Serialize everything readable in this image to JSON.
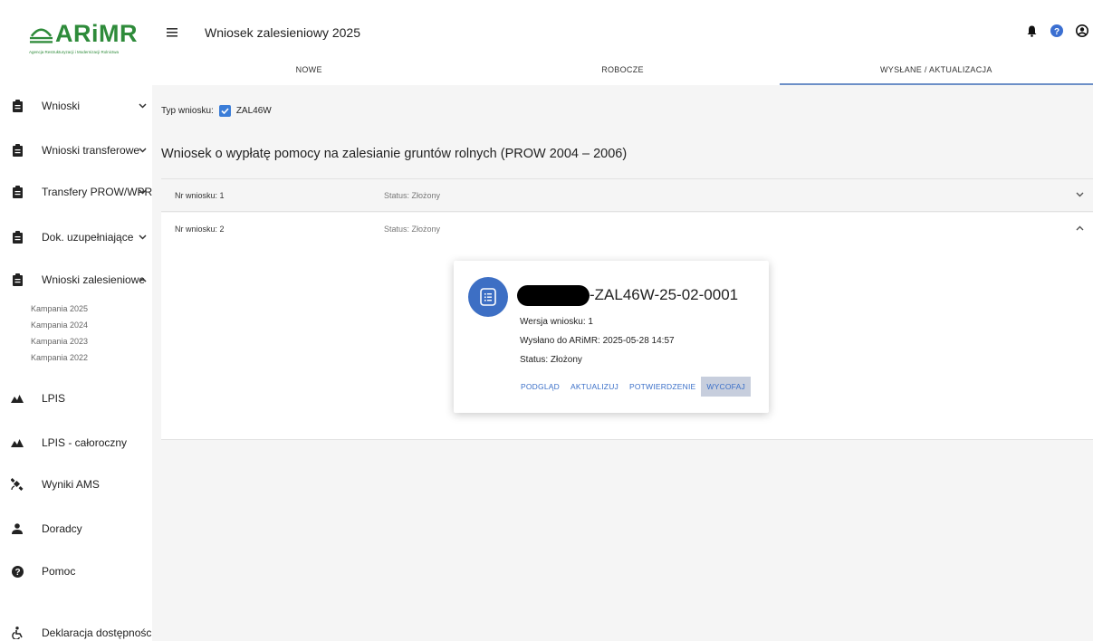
{
  "logo": {
    "text": "ARiMR",
    "subtitle": "Agencja Restrukturyzacji i Modernizacji Rolnictwa"
  },
  "sidebar": {
    "items": [
      {
        "label": "Wnioski",
        "icon": "clipboard-icon",
        "chevron": "⌄"
      },
      {
        "label": "Wnioski transferowe",
        "icon": "clipboard-icon",
        "chevron": "⌄"
      },
      {
        "label": "Transfery PROW/WPR",
        "icon": "clipboard-icon",
        "chevron": "⌄"
      },
      {
        "label": "Dok. uzupełniające",
        "icon": "clipboard-icon",
        "chevron": "⌄"
      },
      {
        "label": "Wnioski zalesieniowe",
        "icon": "clipboard-icon",
        "chevron": "^"
      },
      {
        "label": "LPIS",
        "icon": "mountain-icon"
      },
      {
        "label": "LPIS - całoroczny",
        "icon": "mountain-icon"
      },
      {
        "label": "Wyniki AMS",
        "icon": "satellite-icon"
      },
      {
        "label": "Doradcy",
        "icon": "person-icon"
      },
      {
        "label": "Pomoc",
        "icon": "question-icon"
      },
      {
        "label": "Deklaracja dostępności",
        "icon": "accessibility-icon"
      }
    ],
    "subitems": [
      "Kampania 2025",
      "Kampania 2024",
      "Kampania 2023",
      "Kampania 2022"
    ]
  },
  "header": {
    "title": "Wniosek zalesieniowy 2025",
    "tabs": [
      "NOWE",
      "ROBOCZE",
      "WYSŁANE / AKTUALIZACJA"
    ],
    "active_tab": 2
  },
  "main": {
    "type_label": "Typ wniosku:",
    "type_value": "ZAL46W",
    "section_title": "Wniosek o wypłatę pomocy na zalesianie gruntów rolnych (PROW 2004 – 2006)",
    "applications": [
      {
        "nr": "Nr wniosku: 1",
        "status": "Status: Złożony",
        "expanded": false
      },
      {
        "nr": "Nr wniosku: 2",
        "status": "Status: Złożony",
        "expanded": true
      }
    ],
    "card": {
      "id_suffix": "-ZAL46W-25-02-0001",
      "version": "Wersja wniosku: 1",
      "sent": "Wysłano do ARiMR: 2025-05-28 14:57",
      "status": "Status: Złożony",
      "actions": [
        "PODGLĄD",
        "AKTUALIZUJ",
        "POTWIERDZENIE",
        "WYCOFAJ"
      ]
    }
  },
  "colors": {
    "accent": "#3d6fc4",
    "logo": "#2e8b3a",
    "main_bg": "#f5f5f5",
    "highlight": "#c7cedd"
  }
}
